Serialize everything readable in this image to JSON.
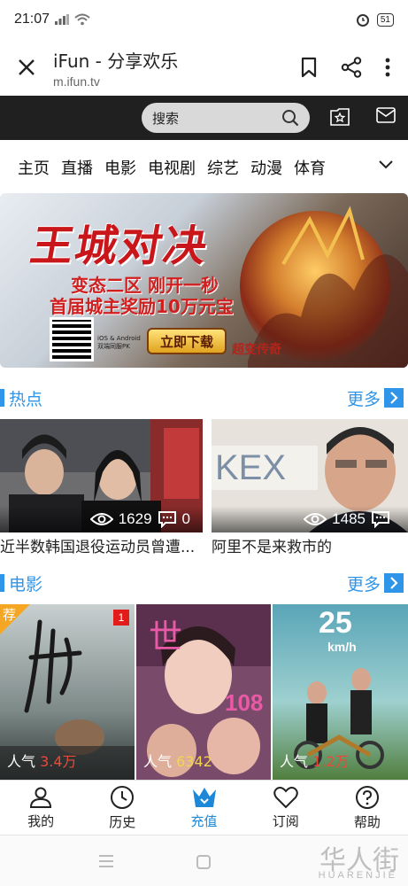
{
  "status": {
    "time": "21:07",
    "battery": "51"
  },
  "browser": {
    "title": "iFun - 分享欢乐",
    "url": "m.ifun.tv"
  },
  "header": {
    "search_placeholder": "搜索"
  },
  "nav": {
    "items": [
      "主页",
      "直播",
      "电影",
      "电视剧",
      "综艺",
      "动漫",
      "体育"
    ]
  },
  "banner": {
    "headline": "王城对决",
    "line1": "变态二区 刚开一秒",
    "line2": "首届城主奖励10万元宝",
    "qr_caption": "iOS & Android 双端同服PK",
    "download": "立即下载",
    "logo": "超变传奇"
  },
  "hot": {
    "title": "热点",
    "more": "更多",
    "items": [
      {
        "views": "1629",
        "comments": "0",
        "caption": "近半数韩国退役运动员曾遭..."
      },
      {
        "views": "1485",
        "comments": "",
        "caption": "阿里不是来救市的"
      }
    ]
  },
  "movies": {
    "title": "电影",
    "more": "更多",
    "rec_label": "荐",
    "items": [
      {
        "pop_label": "人气",
        "pop": "3.4万",
        "badge": "1"
      },
      {
        "pop_label": "人气",
        "pop": "6342",
        "poster_title": "世",
        "poster_num": "108"
      },
      {
        "pop_label": "人气",
        "pop": "1.2万",
        "poster_title": "25",
        "poster_unit": "km/h"
      }
    ]
  },
  "tabbar": {
    "items": [
      {
        "label": "我的",
        "icon": "user-icon"
      },
      {
        "label": "历史",
        "icon": "clock-icon"
      },
      {
        "label": "充值",
        "icon": "crown-icon"
      },
      {
        "label": "订阅",
        "icon": "heart-icon"
      },
      {
        "label": "帮助",
        "icon": "help-icon"
      }
    ]
  },
  "watermark": {
    "cn": "华人街",
    "en": "HUARENJIE"
  },
  "colors": {
    "accent": "#2e95e8",
    "dark_header": "#202020",
    "tab_active": "#1e88d8",
    "pop_highlight_red": "#e84a3a",
    "pop_highlight_yellow": "#f2d64b"
  }
}
